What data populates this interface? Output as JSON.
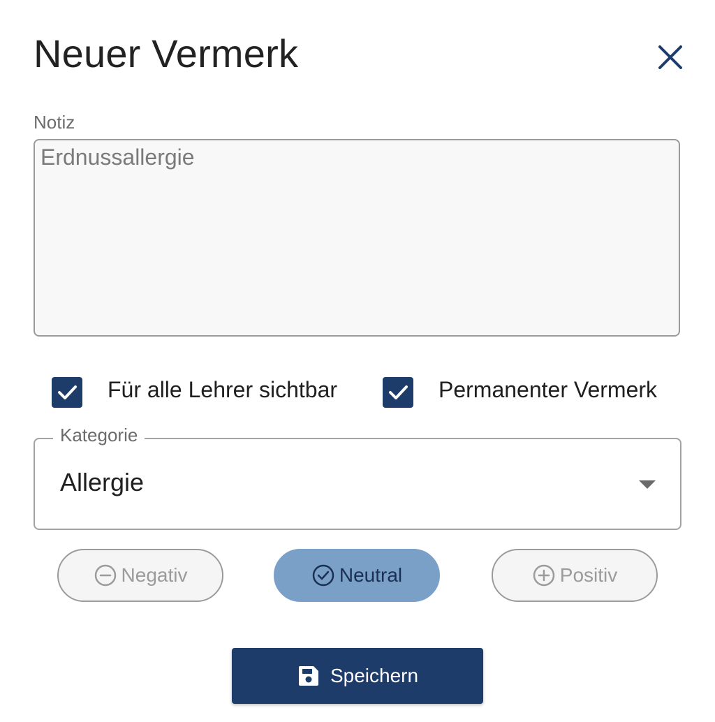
{
  "dialog": {
    "title": "Neuer Vermerk",
    "close_icon": "close-icon"
  },
  "note": {
    "label": "Notiz",
    "value": "Erdnussallergie"
  },
  "checkboxes": [
    {
      "label": "Für alle Lehrer sichtbar",
      "checked": true
    },
    {
      "label": "Permanenter Vermerk",
      "checked": true
    }
  ],
  "category": {
    "label": "Kategorie",
    "value": "Allergie"
  },
  "sentiment": {
    "options": [
      {
        "label": "Negativ",
        "icon": "minus-circle-icon",
        "selected": false
      },
      {
        "label": "Neutral",
        "icon": "check-circle-icon",
        "selected": true
      },
      {
        "label": "Positiv",
        "icon": "plus-circle-icon",
        "selected": false
      }
    ]
  },
  "actions": {
    "save_label": "Speichern",
    "save_icon": "save-icon"
  },
  "colors": {
    "primary": "#1d3c6a",
    "selected_pill": "#7aa0c8",
    "muted": "#9b9b9b"
  }
}
